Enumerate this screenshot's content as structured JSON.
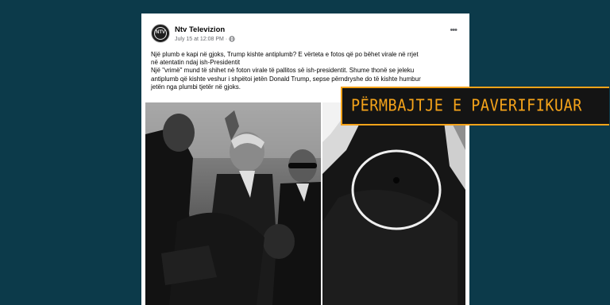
{
  "post": {
    "page_name": "Ntv Televizion",
    "avatar_text": "NTV",
    "timestamp": "July 15 at 12:08 PM",
    "separator": "·",
    "privacy_icon": "globe-icon",
    "more_label": "•••",
    "text_lines": [
      "Një plumb e kapi në gjoks, Trump kishte antiplumb? E vërteta e fotos që po bëhet virale në rrjet",
      "në atentatin ndaj ish-Presidentit",
      "Një \"vrimë\" mund të shihet në foton virale të pallitos së ish-presidentit. Shume thonë se jeleku",
      "antiplumb që kishte veshur i shpëtoi jetën Donald Trump, sepse përndryshe do të kishte humbur",
      "jetën nga plumbi tjetër në gjoks."
    ]
  },
  "badge": {
    "label": "PËRMBAJTJE E PAVERIFIKUAR"
  },
  "colors": {
    "background": "#0c3a4a",
    "badge_accent": "#f5a31a"
  }
}
